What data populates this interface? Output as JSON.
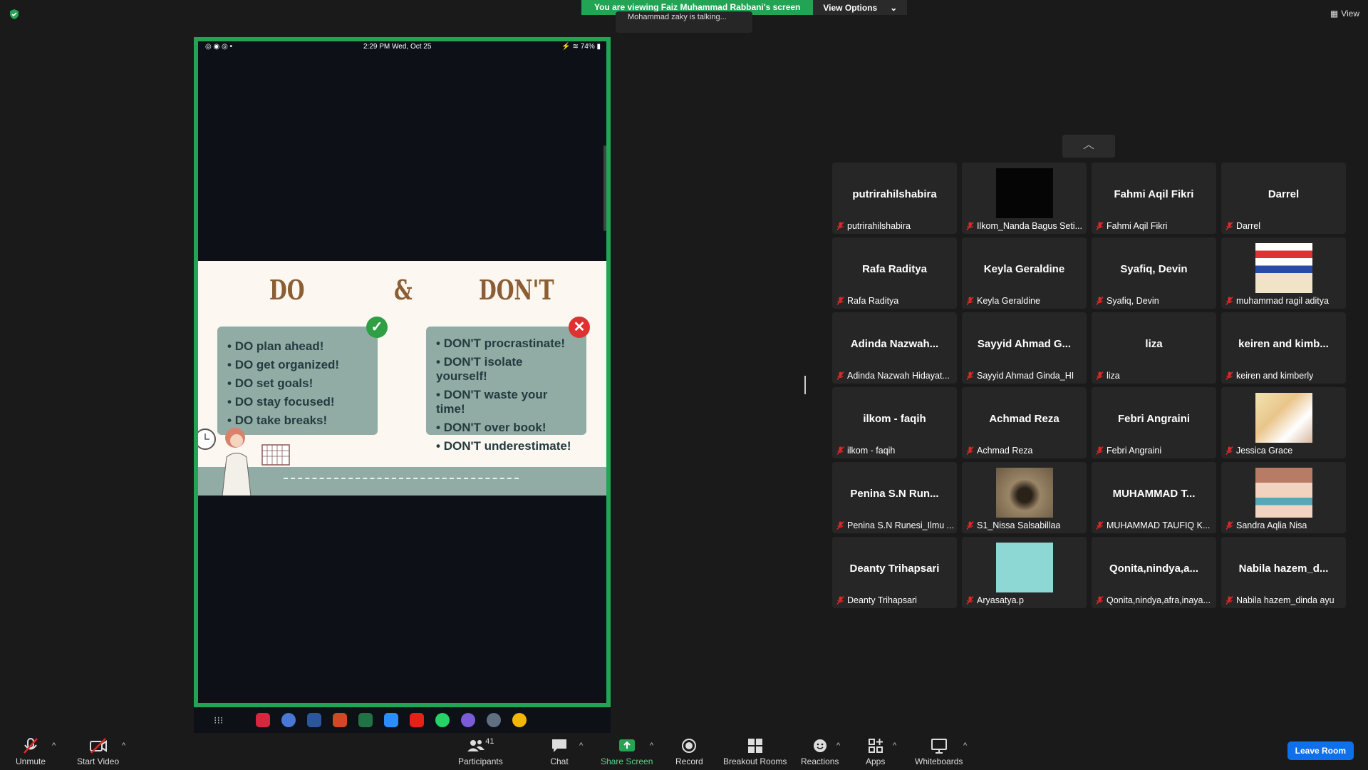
{
  "banner": {
    "viewing": "You are viewing Faiz Muhammad Rabbani's screen",
    "view_options": "View Options"
  },
  "talking": "Mohammad zaky is talking...",
  "view_button": "View",
  "phone": {
    "status_time": "2:29 PM   Wed, Oct 25",
    "battery": "74%"
  },
  "slide": {
    "do_title": "DO",
    "amp": "&",
    "dont_title": "DON'T",
    "do_items": [
      "DO plan ahead!",
      "DO get organized!",
      "DO set goals!",
      "DO stay focused!",
      "DO take breaks!"
    ],
    "dont_items": [
      "DON'T procrastinate!",
      "DON'T isolate yourself!",
      "DON'T waste your time!",
      "DON'T over book!",
      "DON'T underestimate!"
    ]
  },
  "participants": [
    {
      "big": "putrirahilshabira",
      "name": "putrirahilshabira",
      "video": ""
    },
    {
      "big": "",
      "name": "Ilkom_Nanda Bagus Seti...",
      "video": "black"
    },
    {
      "big": "Fahmi Aqil Fikri",
      "name": "Fahmi Aqil Fikri",
      "video": ""
    },
    {
      "big": "Darrel",
      "name": "Darrel",
      "video": ""
    },
    {
      "big": "Rafa Raditya",
      "name": "Rafa Raditya",
      "video": ""
    },
    {
      "big": "Keyla Geraldine",
      "name": "Keyla Geraldine",
      "video": ""
    },
    {
      "big": "Syafiq, Devin",
      "name": "Syafiq, Devin",
      "video": ""
    },
    {
      "big": "",
      "name": "muhammad ragil aditya",
      "video": "cartoon"
    },
    {
      "big": "Adinda  Nazwah...",
      "name": "Adinda Nazwah Hidayat...",
      "video": ""
    },
    {
      "big": "Sayyid Ahmad G...",
      "name": "Sayyid Ahmad Ginda_HI",
      "video": ""
    },
    {
      "big": "liza",
      "name": "liza",
      "video": ""
    },
    {
      "big": "keiren  and  kimb...",
      "name": "keiren and kimberly",
      "video": ""
    },
    {
      "big": "ilkom - faqih",
      "name": "ilkom - faqih",
      "video": ""
    },
    {
      "big": "Achmad Reza",
      "name": "Achmad Reza",
      "video": ""
    },
    {
      "big": "Febri Angraini",
      "name": "Febri Angraini",
      "video": ""
    },
    {
      "big": "",
      "name": "Jessica Grace",
      "video": "anime"
    },
    {
      "big": "Penina S.N Run...",
      "name": "Penina S.N Runesi_Ilmu ...",
      "video": ""
    },
    {
      "big": "",
      "name": "S1_Nissa Salsabillaa",
      "video": "photo"
    },
    {
      "big": "MUHAMMAD  T...",
      "name": "MUHAMMAD TAUFIQ K...",
      "video": ""
    },
    {
      "big": "",
      "name": "Sandra Aqlia Nisa",
      "video": "anime2"
    },
    {
      "big": "Deanty Trihapsari",
      "name": "Deanty Trihapsari",
      "video": ""
    },
    {
      "big": "",
      "name": "Aryasatya.p",
      "video": "teal"
    },
    {
      "big": "Qonita,nindya,a...",
      "name": "Qonita,nindya,afra,inaya...",
      "video": ""
    },
    {
      "big": "Nabila  hazem_d...",
      "name": "Nabila hazem_dinda ayu",
      "video": ""
    }
  ],
  "toolbar": {
    "unmute": "Unmute",
    "start_video": "Start Video",
    "participants": "Participants",
    "participant_count": "41",
    "chat": "Chat",
    "share_screen": "Share Screen",
    "record": "Record",
    "breakout": "Breakout Rooms",
    "reactions": "Reactions",
    "apps": "Apps",
    "whiteboards": "Whiteboards",
    "leave": "Leave Room"
  },
  "colors": {
    "accent_green": "#23a455",
    "leave_blue": "#0e71eb",
    "mute_red": "#e02828"
  }
}
